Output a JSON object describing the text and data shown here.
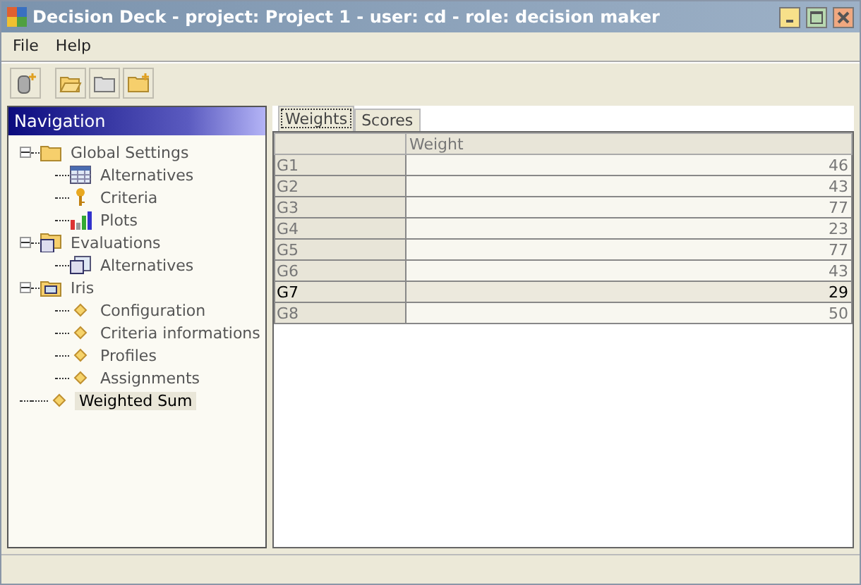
{
  "window": {
    "title": "Decision Deck - project: Project 1 - user: cd - role: decision maker"
  },
  "menu": [
    "File",
    "Help"
  ],
  "navigation": {
    "title": "Navigation",
    "items": [
      {
        "label": "Global Settings",
        "kind": "folder",
        "expanded": true,
        "selected": false,
        "children": [
          {
            "label": "Alternatives",
            "kind": "table",
            "selected": false
          },
          {
            "label": "Criteria",
            "kind": "key",
            "selected": false
          },
          {
            "label": "Plots",
            "kind": "chart",
            "selected": false
          }
        ]
      },
      {
        "label": "Evaluations",
        "kind": "matrix-folder",
        "expanded": true,
        "selected": false,
        "children": [
          {
            "label": "Alternatives",
            "kind": "matrix",
            "selected": false
          }
        ]
      },
      {
        "label": "Iris",
        "kind": "m-folder",
        "expanded": true,
        "selected": false,
        "children": [
          {
            "label": "Configuration",
            "kind": "diamond",
            "selected": false
          },
          {
            "label": "Criteria informations",
            "kind": "diamond",
            "selected": false
          },
          {
            "label": "Profiles",
            "kind": "diamond",
            "selected": false
          },
          {
            "label": "Assignments",
            "kind": "diamond",
            "selected": false
          }
        ]
      },
      {
        "label": "Weighted Sum",
        "kind": "diamond",
        "selected": true
      }
    ]
  },
  "tabs": [
    {
      "label": "Weights",
      "selected": true
    },
    {
      "label": "Scores",
      "selected": false
    }
  ],
  "table": {
    "columns": [
      "Weight"
    ],
    "rows": [
      {
        "name": "G1",
        "value": "46",
        "selected": false
      },
      {
        "name": "G2",
        "value": "43",
        "selected": false
      },
      {
        "name": "G3",
        "value": "77",
        "selected": false
      },
      {
        "name": "G4",
        "value": "23",
        "selected": false
      },
      {
        "name": "G5",
        "value": "77",
        "selected": false
      },
      {
        "name": "G6",
        "value": "43",
        "selected": false
      },
      {
        "name": "G7",
        "value": "29",
        "selected": true
      },
      {
        "name": "G8",
        "value": "50",
        "selected": false
      }
    ]
  }
}
